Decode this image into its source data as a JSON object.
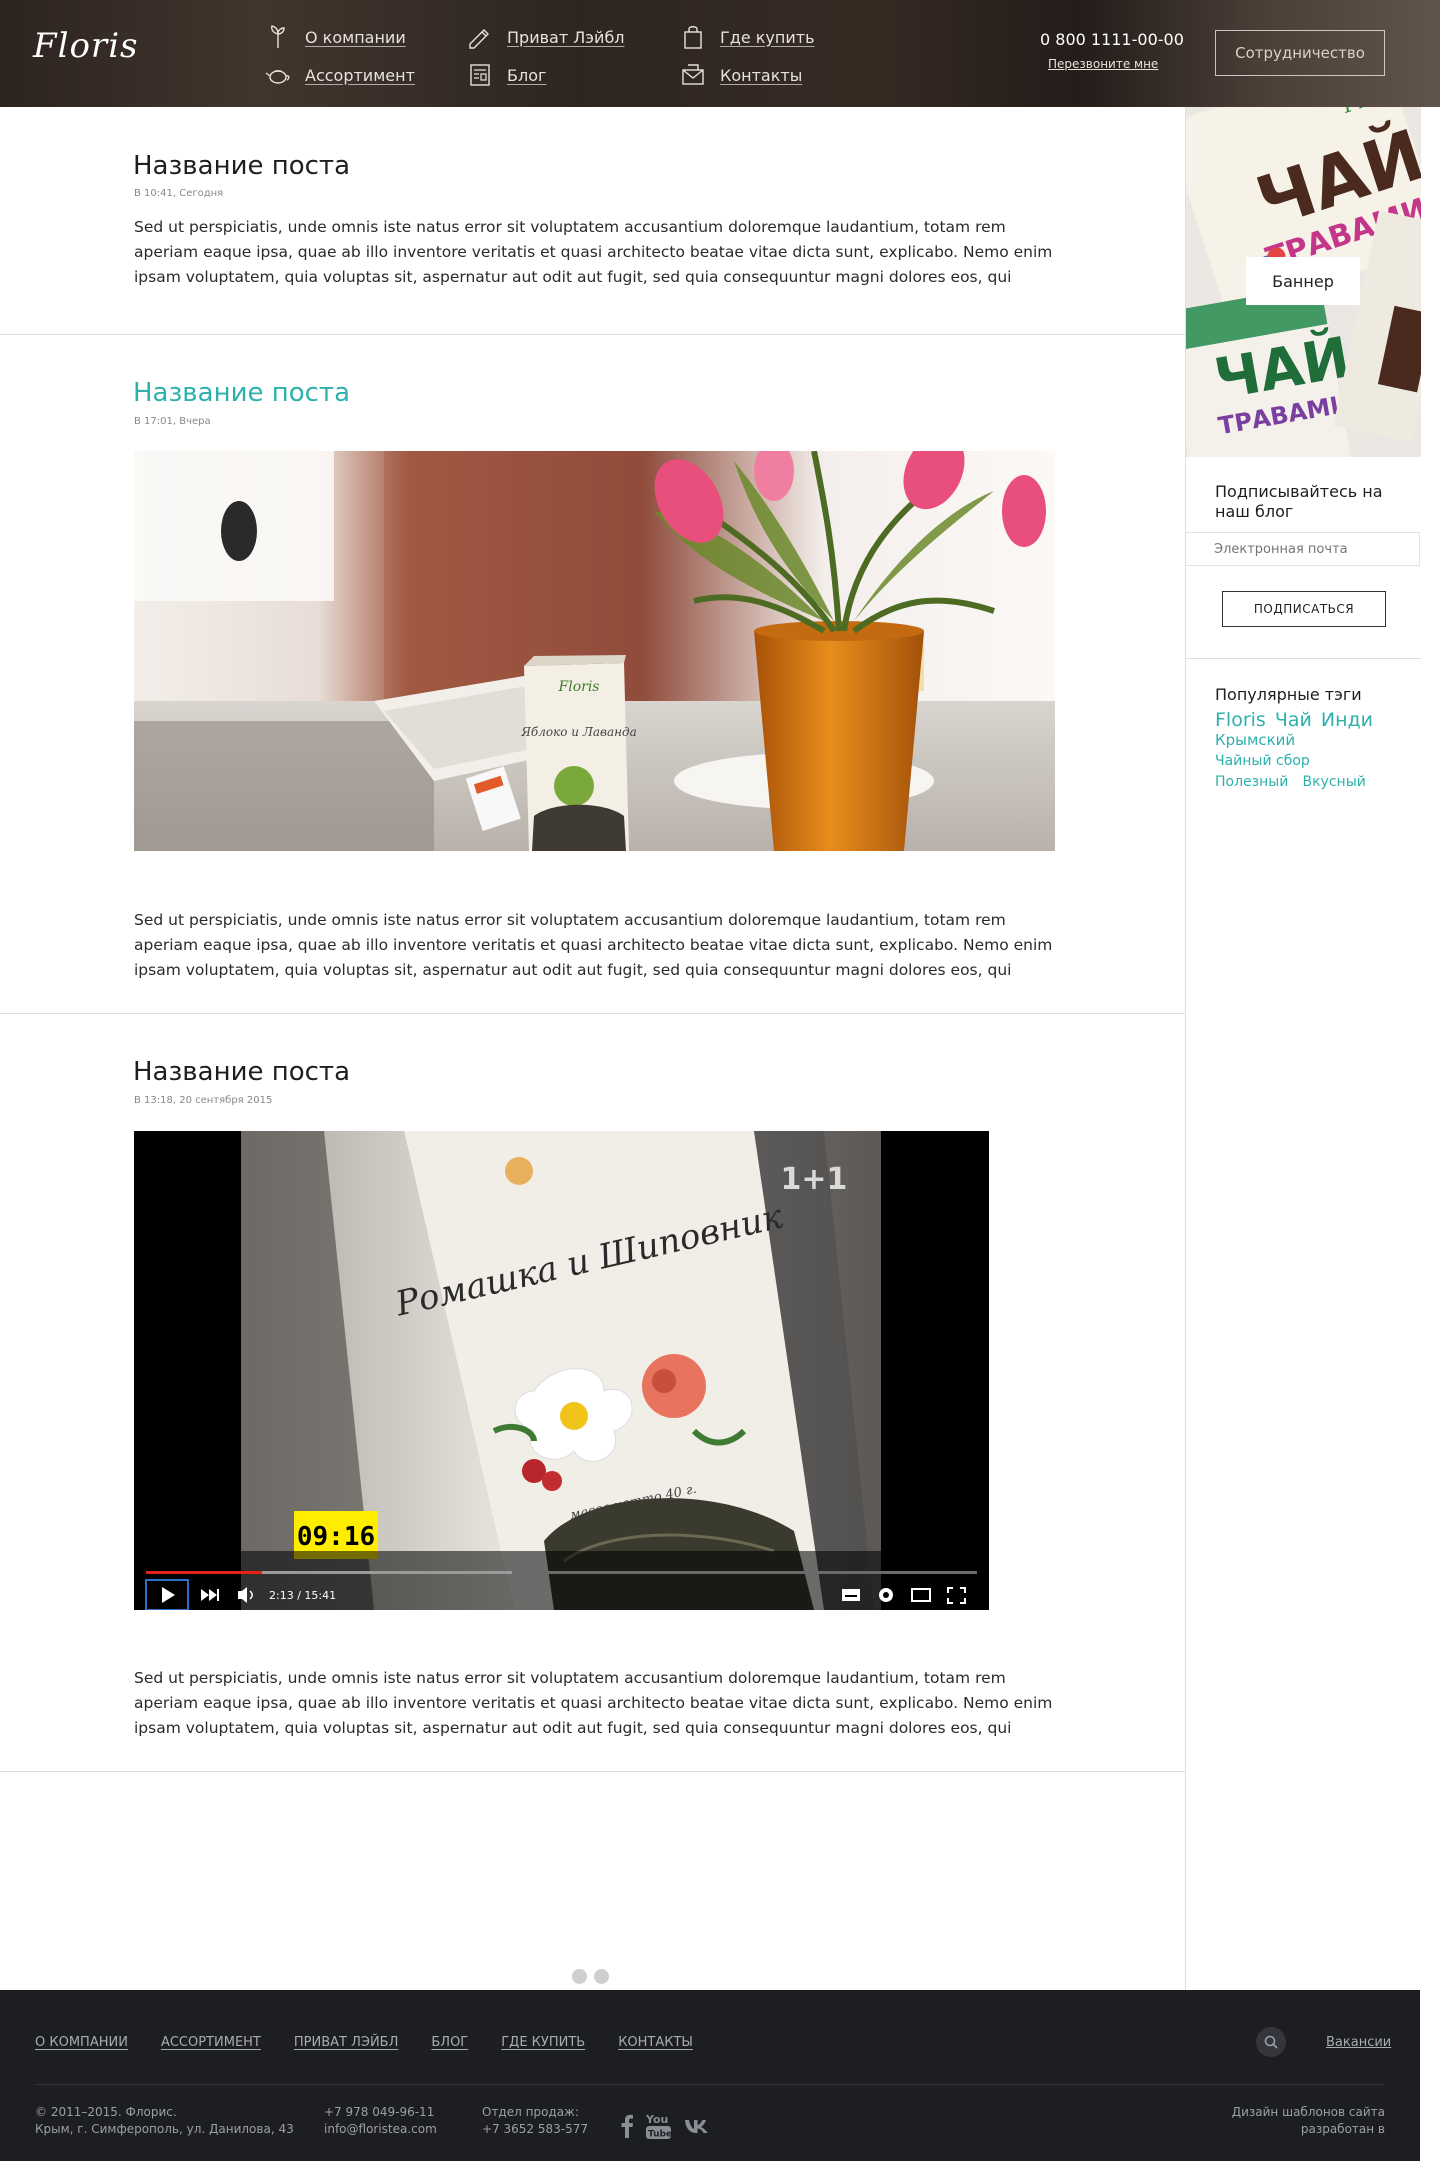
{
  "header": {
    "logo": "Floris",
    "nav": [
      {
        "label": "О компании",
        "icon": "leaf-icon"
      },
      {
        "label": "Ассортимент",
        "icon": "teapot-icon"
      },
      {
        "label": "Приват Лэйбл",
        "icon": "pencil-icon"
      },
      {
        "label": "Блог",
        "icon": "newspaper-icon"
      },
      {
        "label": "Где купить",
        "icon": "shopping-bag-icon"
      },
      {
        "label": "Контакты",
        "icon": "mail-icon"
      }
    ],
    "phone": "0 800 1111-00-00",
    "callback": "Перезвоните мне",
    "coop_button": "Сотрудничество"
  },
  "posts": [
    {
      "title": "Название поста",
      "meta": "В 10:41, Сегодня",
      "text": "Sed ut perspiciatis, unde omnis iste natus error sit voluptatem accusantium doloremque laudantium, totam rem aperiam eaque ipsa, quae ab illo inventore veritatis et quasi architecto beatae vitae dicta sunt, explicabo. Nemo enim ipsam voluptatem, quia voluptas sit, aspernatur aut odit aut fugit, sed quia consequuntur magni dolores eos, qui"
    },
    {
      "title": "Название поста",
      "meta": "В 17:01, Вчера",
      "photo_box_brand": "Floris",
      "photo_box_text": "Яблоко и Лаванда",
      "text": "Sed ut perspiciatis, unde omnis iste natus error sit voluptatem accusantium doloremque laudantium, totam rem aperiam eaque ipsa, quae ab illo inventore veritatis et quasi architecto beatae vitae dicta sunt, explicabo. Nemo enim ipsam voluptatem, quia voluptas sit, aspernatur aut odit aut fugit, sed quia consequuntur magni dolores eos, qui"
    },
    {
      "title": "Название поста",
      "meta": "В 13:18, 20 сентября 2015",
      "video": {
        "channel_logo": "1+1",
        "box_text": "Ромашка и Шиповник",
        "box_weight": "масса нетто 40 г.",
        "clock": "09:16",
        "time": "2:13 / 15:41",
        "played": 0.14,
        "buffered": 0.44
      },
      "text": "Sed ut perspiciatis, unde omnis iste natus error sit voluptatem accusantium doloremque laudantium, totam rem aperiam eaque ipsa, quae ab illo inventore veritatis et quasi architecto beatae vitae dicta sunt, explicabo. Nemo enim ipsam voluptatem, quia voluptas sit, aspernatur aut odit aut fugit, sed quia consequuntur magni dolores eos, qui"
    }
  ],
  "sidebar": {
    "banner_label": "Баннер",
    "banner_box1_brand": "Floris",
    "banner_box1_text": "ЧАЙ",
    "banner_box1_sub": "ТРАВАМИ",
    "banner_box2_text": "ЧАЙ",
    "banner_box2_sub": "ТРАВАМИ",
    "subscribe_title": "Подписывайтесь на наш блог",
    "email_placeholder": "Электронная почта",
    "subscribe_button": "ПОДПИСАТЬСЯ",
    "tags_title": "Популярные тэги",
    "tags": [
      {
        "label": "Floris",
        "size": "large"
      },
      {
        "label": "Чай",
        "size": "large"
      },
      {
        "label": "Инди",
        "size": "large"
      },
      {
        "label": "Крымский",
        "size": "medium"
      },
      {
        "label": "Чайный сбор",
        "size": "small"
      },
      {
        "label": "Полезный",
        "size": "small"
      },
      {
        "label": "Вкусный",
        "size": "small"
      }
    ]
  },
  "footer": {
    "nav": [
      "О КОМПАНИИ",
      "АССОРТИМЕНТ",
      "ПРИВАТ ЛЭЙБЛ",
      "БЛОГ",
      "ГДЕ КУПИТЬ",
      "КОНТАКТЫ"
    ],
    "jobs": "Вакансии",
    "copyright": "© 2011–2015. Флорис.",
    "address": "Крым, г. Симферополь, ул. Данилова, 43",
    "phone": "+7 978 049-96-11",
    "email": "info@floristea.com",
    "sales_label": "Отдел продаж:",
    "sales_phone": "+7 3652 583-577",
    "design_line1": "Дизайн шаблонов сайта",
    "design_line2": "разработан в"
  },
  "colors": {
    "accent": "#2eb1ad",
    "footer_bg": "#1d1e22",
    "progress_red": "#e62117"
  }
}
